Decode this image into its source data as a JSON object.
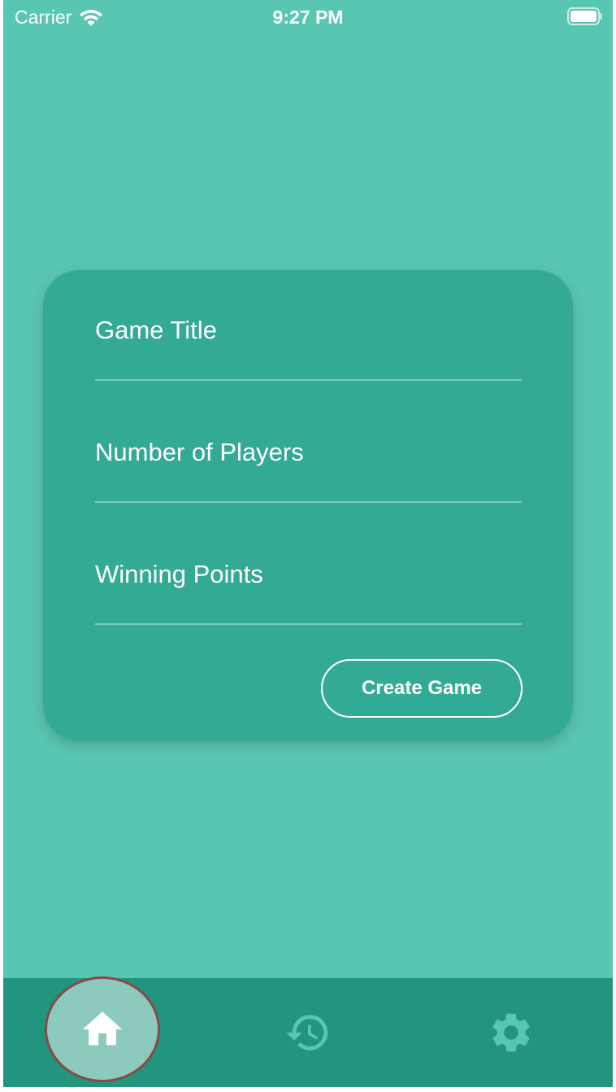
{
  "status_bar": {
    "carrier": "Carrier",
    "time": "9:27 PM"
  },
  "form": {
    "game_title_placeholder": "Game Title",
    "players_placeholder": "Number of Players",
    "winning_points_placeholder": "Winning Points",
    "create_button_label": "Create Game"
  },
  "tabs": [
    {
      "icon": "home-icon",
      "selected": true
    },
    {
      "icon": "history-icon",
      "selected": false
    },
    {
      "icon": "gear-icon",
      "selected": false
    }
  ],
  "colors": {
    "background": "#59c6b1",
    "card": "#32aa94",
    "tab_bar": "#21957e",
    "accent_icon": "#59c6b1",
    "selected_tab_bg": "#8ccabd",
    "selected_tab_border": "#8a4a44"
  }
}
